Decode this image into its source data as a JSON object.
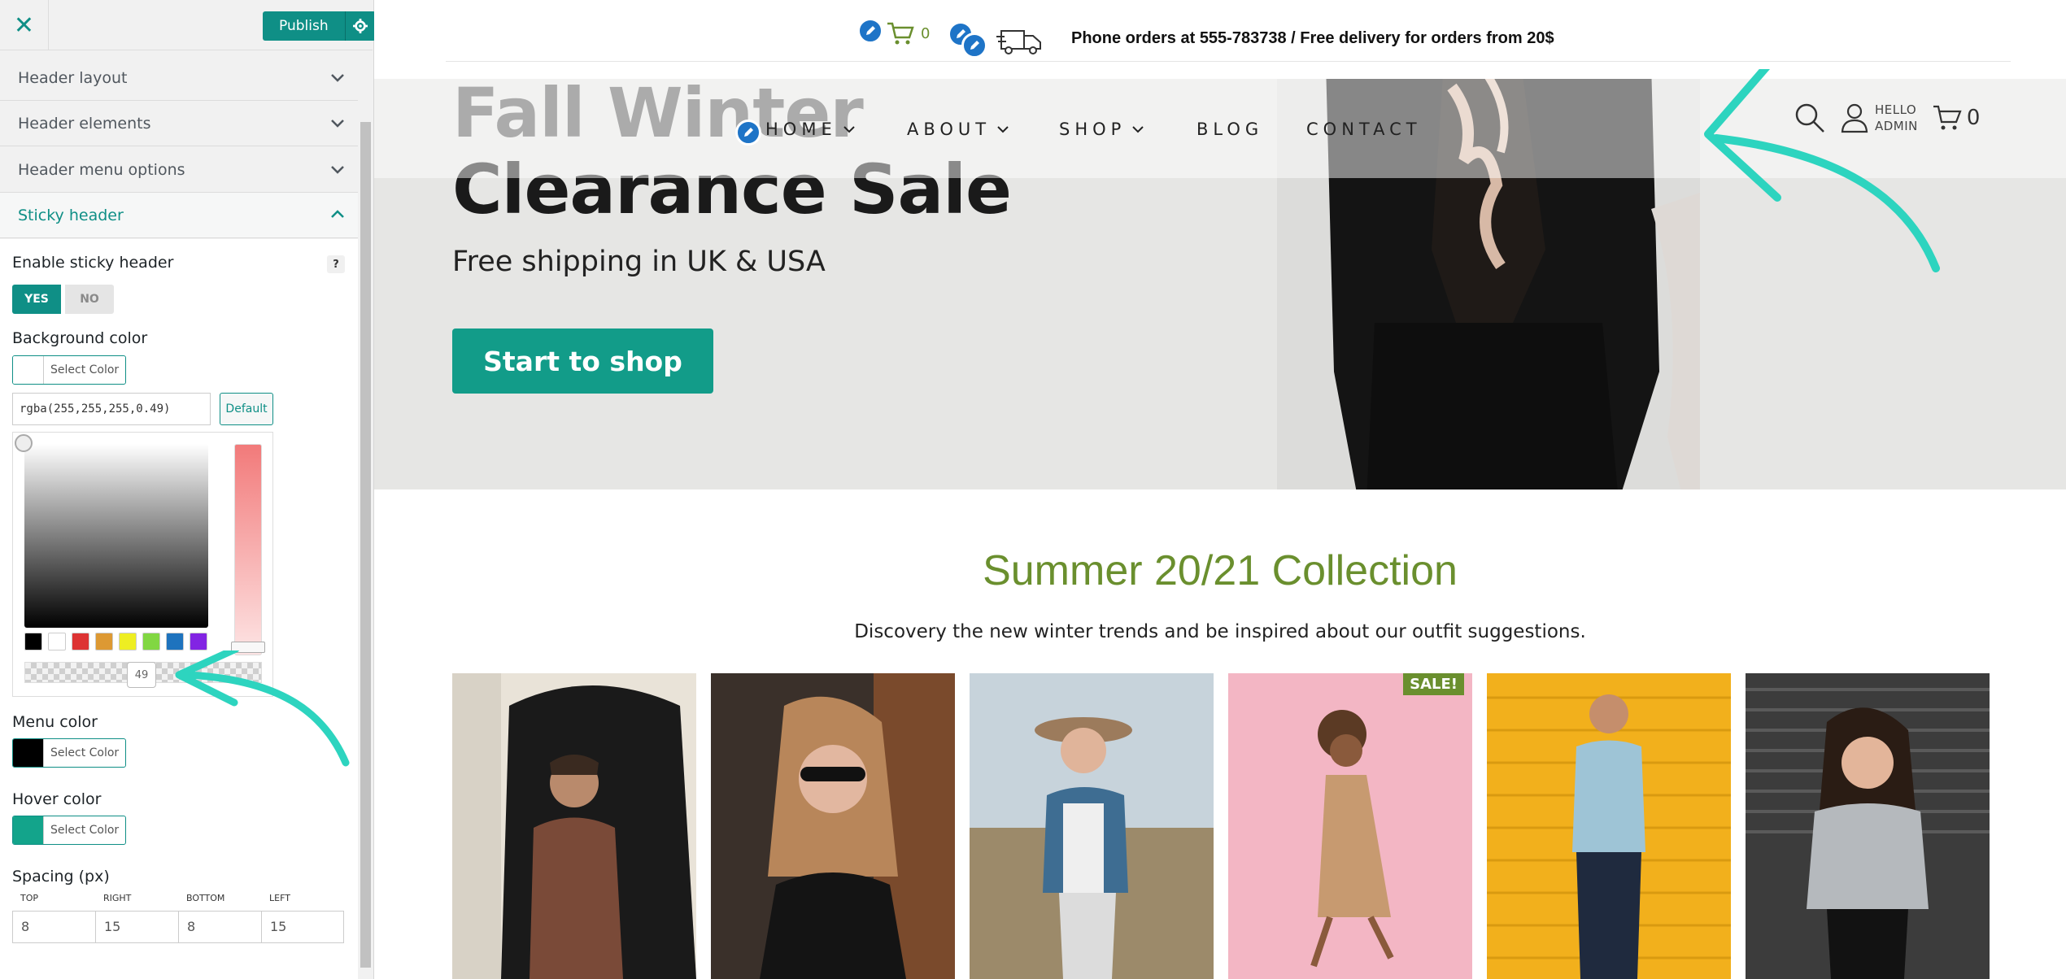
{
  "sidebar": {
    "close_label": "✕",
    "publish_label": "Publish",
    "sections": [
      {
        "label": "Header layout"
      },
      {
        "label": "Header elements"
      },
      {
        "label": "Header menu options"
      },
      {
        "label": "Sticky header"
      }
    ],
    "enable_sticky_label": "Enable sticky header",
    "help": "?",
    "toggle_yes": "YES",
    "toggle_no": "NO",
    "bg_color_label": "Background color",
    "select_color": "Select Color",
    "bg_color_value": "rgba(255,255,255,0.49)",
    "default_label": "Default",
    "alpha_value": "49",
    "menu_color_label": "Menu color",
    "hover_color_label": "Hover color",
    "spacing_label": "Spacing (px)",
    "spacing": [
      {
        "head": "TOP",
        "value": "8"
      },
      {
        "head": "RIGHT",
        "value": "15"
      },
      {
        "head": "BOTTOM",
        "value": "8"
      },
      {
        "head": "LEFT",
        "value": "15"
      }
    ],
    "palette": [
      "#000000",
      "#ffffff",
      "#dd3333",
      "#dd9933",
      "#eeee22",
      "#81d742",
      "#1e73be",
      "#8224e3"
    ],
    "menu_color": "#000000",
    "hover_color": "#13a48b"
  },
  "preview": {
    "cart_count_top": "0",
    "phone_text": "Phone orders at 555-783738 / Free delivery for orders from 20$",
    "hero_title_line1": "Fall Winter",
    "hero_title_line2": "Clearance Sale",
    "hero_subtitle": "Free shipping in UK & USA",
    "hero_button": "Start to shop",
    "nav": [
      {
        "label": "HOME"
      },
      {
        "label": "ABOUT"
      },
      {
        "label": "SHOP"
      },
      {
        "label": "BLOG"
      },
      {
        "label": "CONTACT"
      }
    ],
    "hello": "HELLO",
    "admin": "ADMIN",
    "cart_count_nav": "0",
    "collection_title": "Summer 20/21 Collection",
    "collection_desc": "Discovery the new winter trends and be inspired about our outfit suggestions.",
    "sale_badge": "SALE!"
  },
  "colors": {
    "accent": "#0f8f86",
    "brand_green": "#6a8f2e",
    "button_teal": "#129c89",
    "annotation_arrow": "#2dd4bf"
  }
}
